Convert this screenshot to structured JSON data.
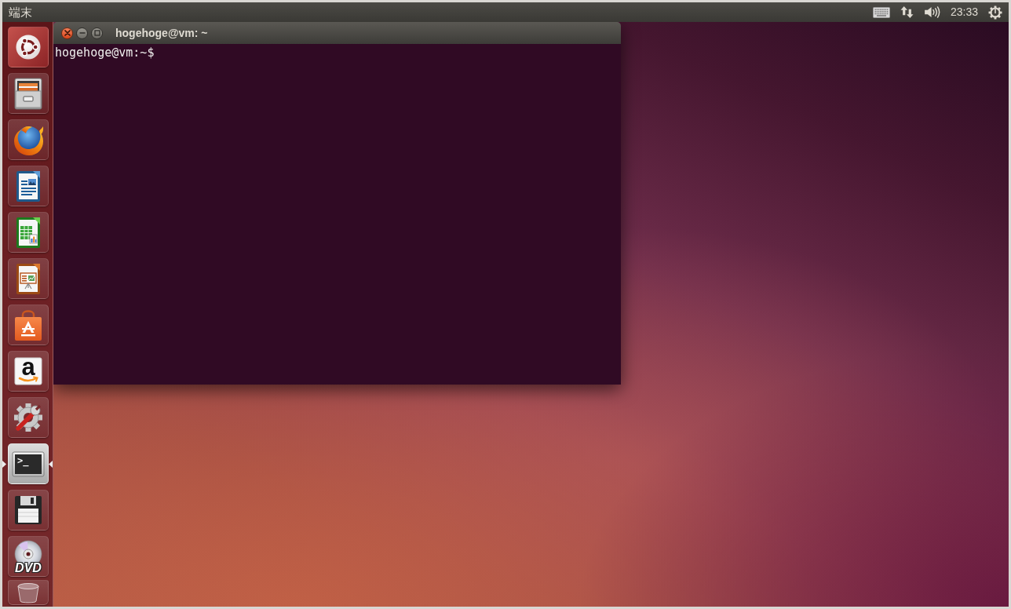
{
  "top_bar": {
    "title": "端末",
    "clock": "23:33"
  },
  "launcher": {
    "items": [
      {
        "kind": "dash",
        "running": false,
        "focused": false
      },
      {
        "kind": "files",
        "running": false,
        "focused": false
      },
      {
        "kind": "browser",
        "running": false,
        "focused": false
      },
      {
        "kind": "writer",
        "running": false,
        "focused": false
      },
      {
        "kind": "calc",
        "running": false,
        "focused": false
      },
      {
        "kind": "impress",
        "running": false,
        "focused": false
      },
      {
        "kind": "store",
        "running": false,
        "focused": false
      },
      {
        "kind": "amazon",
        "label": "a",
        "running": false,
        "focused": false
      },
      {
        "kind": "settings",
        "running": false,
        "focused": false
      },
      {
        "kind": "terminal",
        "label": ">_",
        "running": true,
        "focused": true
      },
      {
        "kind": "floppy",
        "running": false,
        "focused": false
      },
      {
        "kind": "dvd",
        "label": "DVD",
        "running": false,
        "focused": false
      },
      {
        "kind": "trash",
        "running": false,
        "focused": false
      }
    ]
  },
  "terminal": {
    "title": "hogehoge@vm: ~",
    "lines": [
      "hogehoge@vm:~$"
    ]
  }
}
